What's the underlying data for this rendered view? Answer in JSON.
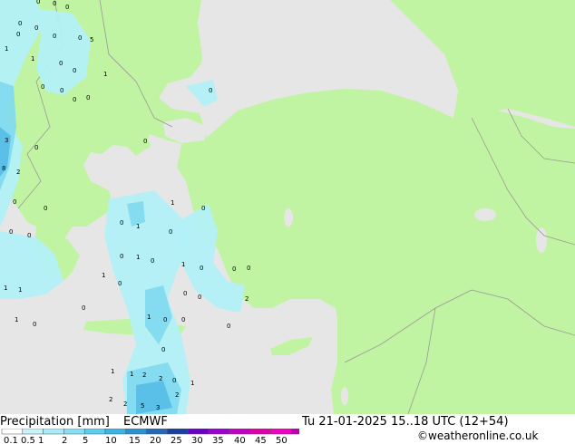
{
  "map": {
    "colors": {
      "sea": "#e6e6e6",
      "land": "#c1f4a2",
      "border": "#999999",
      "precip_light": "#b2f0f7",
      "precip_mid": "#7fd9f0",
      "precip_heavy": "#55bde6"
    },
    "point_values": [
      "0",
      "0",
      "0",
      "0",
      "0",
      "0",
      "5",
      "1",
      "1",
      "0",
      "0",
      "1",
      "0",
      "0",
      "0",
      "0",
      "0",
      "0",
      "0",
      "3",
      "8",
      "2",
      "0",
      "0",
      "0",
      "0",
      "0",
      "1",
      "0",
      "0",
      "0",
      "0",
      "1",
      "1",
      "0",
      "1",
      "0",
      "0",
      "1",
      "0",
      "0",
      "0",
      "0",
      "0",
      "2",
      "0",
      "1",
      "1",
      "1",
      "0",
      "0",
      "1",
      "0",
      "0",
      "0",
      "1",
      "1",
      "2",
      "2",
      "0",
      "2",
      "2",
      "5",
      "3",
      "2",
      "1"
    ]
  },
  "footer": {
    "left_label": "Precipitation [mm]",
    "model": "ECMWF",
    "timestamp": "Tu 21-01-2025 15..18 UTC (12+54)",
    "credit": "©weatheronline.co.uk",
    "scale_values": [
      "0.1",
      "0.5",
      "1",
      "2",
      "5",
      "10",
      "15",
      "20",
      "25",
      "30",
      "35",
      "40",
      "45",
      "50"
    ],
    "scale_colors": [
      "#ffffff",
      "#c8f3fa",
      "#a9ecf7",
      "#87dff3",
      "#5ccdee",
      "#39b4e4",
      "#2b90cf",
      "#2468b7",
      "#1b3f9e",
      "#6a00c8",
      "#9a00d2",
      "#c200c4",
      "#e000a8",
      "#f000c0",
      "#c000b0"
    ]
  }
}
